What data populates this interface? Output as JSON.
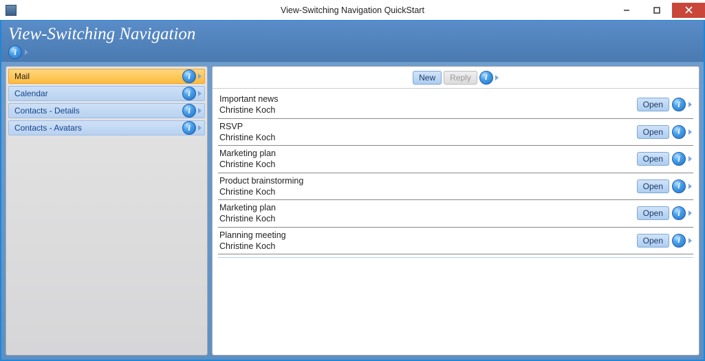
{
  "window": {
    "title": "View-Switching Navigation QuickStart"
  },
  "header": {
    "title": "View-Switching Navigation"
  },
  "sidebar": {
    "items": [
      {
        "label": "Mail",
        "selected": true
      },
      {
        "label": "Calendar",
        "selected": false
      },
      {
        "label": "Contacts - Details",
        "selected": false
      },
      {
        "label": "Contacts - Avatars",
        "selected": false
      }
    ]
  },
  "toolbar": {
    "new_label": "New",
    "reply_label": "Reply"
  },
  "mail": {
    "open_label": "Open",
    "items": [
      {
        "subject": "Important news",
        "sender": "Christine Koch"
      },
      {
        "subject": "RSVP",
        "sender": "Christine Koch"
      },
      {
        "subject": "Marketing plan",
        "sender": "Christine Koch"
      },
      {
        "subject": "Product brainstorming",
        "sender": "Christine Koch"
      },
      {
        "subject": "Marketing plan",
        "sender": "Christine Koch"
      },
      {
        "subject": "Planning meeting",
        "sender": "Christine Koch"
      }
    ]
  }
}
